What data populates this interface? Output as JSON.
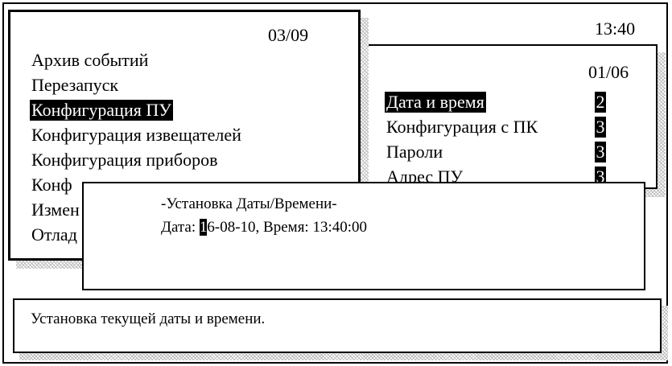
{
  "clock": "13:40",
  "main_menu": {
    "page": "03/09",
    "items": [
      {
        "label": "Архив событий"
      },
      {
        "label": "Перезапуск"
      },
      {
        "label": "Конфигурация ПУ",
        "selected": true
      },
      {
        "label": "Конфигурация извещателей"
      },
      {
        "label": "Конфигурация приборов"
      },
      {
        "label": "Конф"
      },
      {
        "label": "Измен"
      },
      {
        "label": "Отлад"
      }
    ]
  },
  "sub_menu": {
    "page": "01/06",
    "items": [
      {
        "label": "Дата и время",
        "level": "2",
        "selected": true
      },
      {
        "label": "Конфигурация с ПК",
        "level": "3"
      },
      {
        "label": "Пароли",
        "level": "3"
      },
      {
        "label": "Адрес ПУ",
        "level": "3"
      }
    ]
  },
  "dialog": {
    "title": "-Установка Даты/Времени-",
    "date_label": "Дата: ",
    "date_cursor_digit": "1",
    "date_rest": "6-08-10, Время: 13:40:00"
  },
  "status": {
    "text": "Установка текущей даты и времени."
  }
}
